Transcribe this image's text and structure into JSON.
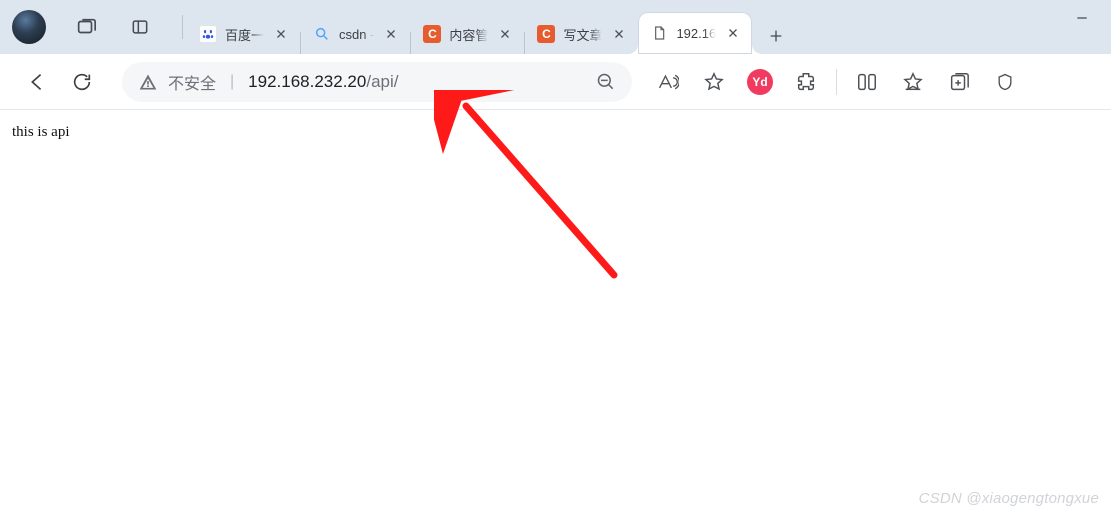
{
  "titlebar": {
    "tabs": [
      {
        "title": "百度一",
        "favicon": "baidu"
      },
      {
        "title": "csdn - ",
        "favicon": "search"
      },
      {
        "title": "内容管",
        "favicon": "c"
      },
      {
        "title": "写文章",
        "favicon": "c"
      },
      {
        "title": "192.16",
        "favicon": "page",
        "active": true
      }
    ]
  },
  "toolbar": {
    "security_text": "不安全",
    "url_host": "192.168.232.20",
    "url_path": "/api/",
    "ext_label": "Yd"
  },
  "page": {
    "body_text": "this is api"
  },
  "watermark": "CSDN @xiaogengtongxue"
}
